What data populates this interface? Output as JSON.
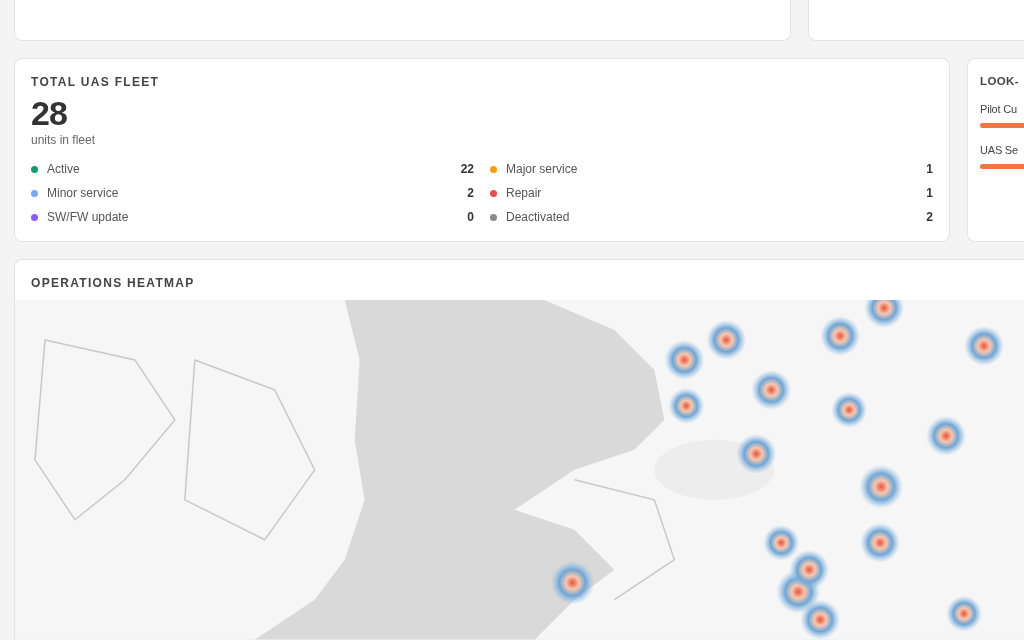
{
  "fleet": {
    "title": "TOTAL UAS FLEET",
    "total": "28",
    "caption": "units in fleet",
    "statuses": [
      {
        "label": "Active",
        "count": "22",
        "color": "#109e6a"
      },
      {
        "label": "Major service",
        "count": "1",
        "color": "#f59e0b"
      },
      {
        "label": "Minor service",
        "count": "2",
        "color": "#7aa7f5"
      },
      {
        "label": "Repair",
        "count": "1",
        "color": "#ec4c4c"
      },
      {
        "label": "SW/FW update",
        "count": "0",
        "color": "#8b5cf6"
      },
      {
        "label": "Deactivated",
        "count": "2",
        "color": "#8a8a8a"
      }
    ]
  },
  "lookahead": {
    "title": "LOOK-",
    "items": [
      {
        "label": "Pilot Cu",
        "level": 1
      },
      {
        "label": "UAS Se",
        "level": 1
      }
    ]
  },
  "heatmap": {
    "title": "OPERATIONS HEATMAP"
  }
}
